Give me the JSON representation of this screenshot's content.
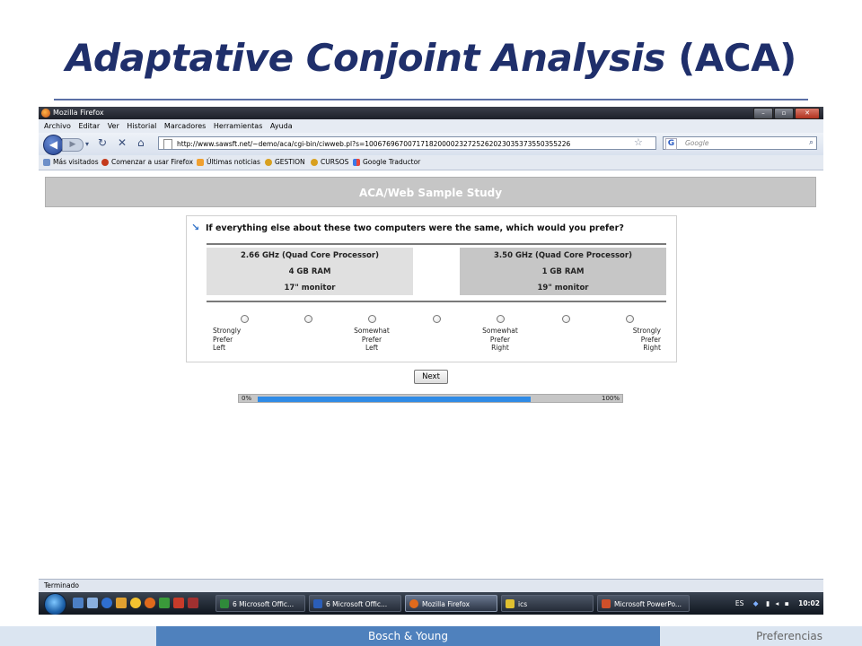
{
  "slide": {
    "title_italic": "Adaptative Conjoint Analysis",
    "title_suffix": " (ACA)",
    "footer_center": "Bosch & Young",
    "footer_right": "Preferencias"
  },
  "browser": {
    "window_title": "Mozilla Firefox",
    "menu": [
      "Archivo",
      "Editar",
      "Ver",
      "Historial",
      "Marcadores",
      "Herramientas",
      "Ayuda"
    ],
    "url": "http://www.sawsft.net/~demo/aca/cgi-bin/ciwweb.pl?s=100676967007171820000232725262023035373550355226",
    "search_placeholder": "Google",
    "search_engine_icon": "G",
    "bookmarks": [
      "Más visitados",
      "Comenzar a usar Firefox",
      "Últimas noticias",
      "GESTION",
      "CURSOS",
      "Google Traductor"
    ],
    "status": "Terminado"
  },
  "survey": {
    "header": "ACA/Web Sample Study",
    "question": "If everything else about these two computers were the same, which would you prefer?",
    "option_left": [
      "2.66 GHz (Quad Core Processor)",
      "4 GB RAM",
      "17\" monitor"
    ],
    "option_right": [
      "3.50 GHz (Quad Core Processor)",
      "1 GB RAM",
      "19\" monitor"
    ],
    "scale_labels": {
      "strongly_left": "Strongly\nPrefer\nLeft",
      "somewhat_left": "Somewhat\nPrefer\nLeft",
      "somewhat_right": "Somewhat\nPrefer\nRight",
      "strongly_right": "Strongly\nPrefer\nRight"
    },
    "scale_points": 7,
    "next_label": "Next",
    "progress": {
      "start_label": "0%",
      "end_label": "100%",
      "value": 0.81
    }
  },
  "taskbar": {
    "tasks": [
      "6 Microsoft Offic...",
      "6 Microsoft Offic...",
      "Mozilla Firefox",
      "ics",
      "Microsoft PowerPo..."
    ],
    "language": "ES",
    "clock": "10:02"
  },
  "colors": {
    "title": "#1f2f6b",
    "footer_accent": "#4f81bd",
    "progress_fill": "#2f8be6",
    "survey_header_bg": "#c6c6c6"
  }
}
